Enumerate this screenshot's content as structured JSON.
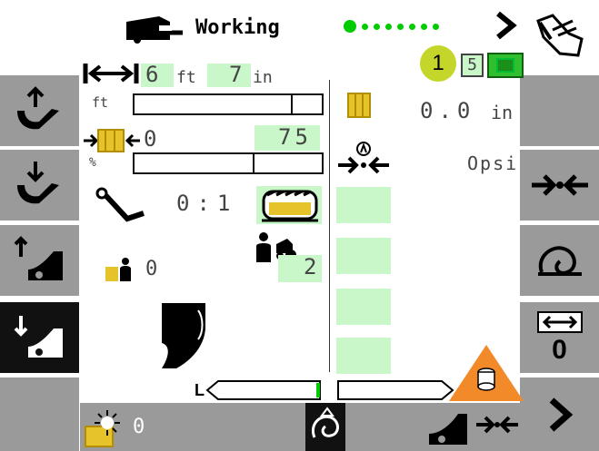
{
  "status": {
    "title": "Working",
    "progress_dots": 8,
    "active_dots": 1
  },
  "indicator": {
    "number": "1",
    "page_box": "5"
  },
  "length": {
    "ft": "6",
    "ft_unit": "ft",
    "in": "7",
    "in_unit": "in"
  },
  "bar1": {
    "unit_label": "ft"
  },
  "bales": {
    "count": "0",
    "max": "75"
  },
  "bar2": {
    "unit_label": "%"
  },
  "ratio": {
    "value": "0:1"
  },
  "bale_counter": {
    "value": "0"
  },
  "operator_value": {
    "value": "2"
  },
  "right_panel": {
    "depth_value": "0.0",
    "depth_unit": "in",
    "pressure_unit": "psi",
    "pressure_prefix": "O"
  },
  "bottom": {
    "sun_value": "0",
    "left_marker": "L"
  },
  "right_buttons": {
    "zero_label": "0"
  },
  "colors": {
    "green_fill": "#c9f7c9",
    "sidebar_gray": "#9a9a9a",
    "warn_orange": "#f28a2a",
    "bale_yellow": "#e6c32b"
  }
}
